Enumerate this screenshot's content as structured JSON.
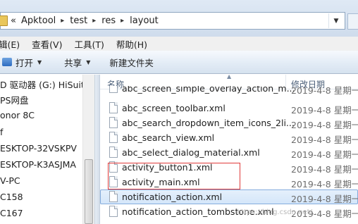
{
  "address": {
    "overflow": "«",
    "crumbs": [
      "Apktool",
      "test",
      "res",
      "layout"
    ]
  },
  "menu": [
    "辑(E)",
    "查看(V)",
    "工具(T)",
    "帮助(H)"
  ],
  "toolbar": {
    "open_label": "打开",
    "share_label": "共享",
    "new_folder_label": "新建文件夹"
  },
  "nav": {
    "items": [
      "D 驱动器 (G:) HiSuite",
      "PS网盘",
      "onor 8C",
      "f",
      "ESKTOP-32VSKPV",
      "ESKTOP-K3ASJMA",
      "V-PC",
      "C158",
      "C167"
    ]
  },
  "columns": {
    "name": "名称",
    "date": "修改日期"
  },
  "files": [
    {
      "name": "abc_screen_simple_overlay_action_m...",
      "date": "2019-4-8 星期一"
    },
    {
      "name": "abc_screen_toolbar.xml",
      "date": "2019-4-8 星期一"
    },
    {
      "name": "abc_search_dropdown_item_icons_2li...",
      "date": "2019-4-8 星期一"
    },
    {
      "name": "abc_search_view.xml",
      "date": "2019-4-8 星期一"
    },
    {
      "name": "abc_select_dialog_material.xml",
      "date": "2019-4-8 星期一"
    },
    {
      "name": "activity_button1.xml",
      "date": "2019-4-8 星期一"
    },
    {
      "name": "activity_main.xml",
      "date": "2019-4-8 星期一"
    },
    {
      "name": "notification_action.xml",
      "date": "2019-4-8 星期一"
    },
    {
      "name": "notification_action_tombstone.xml",
      "date": "2019-4-8 星期一"
    }
  ],
  "watermark": "https://blog.csdn.net/..."
}
